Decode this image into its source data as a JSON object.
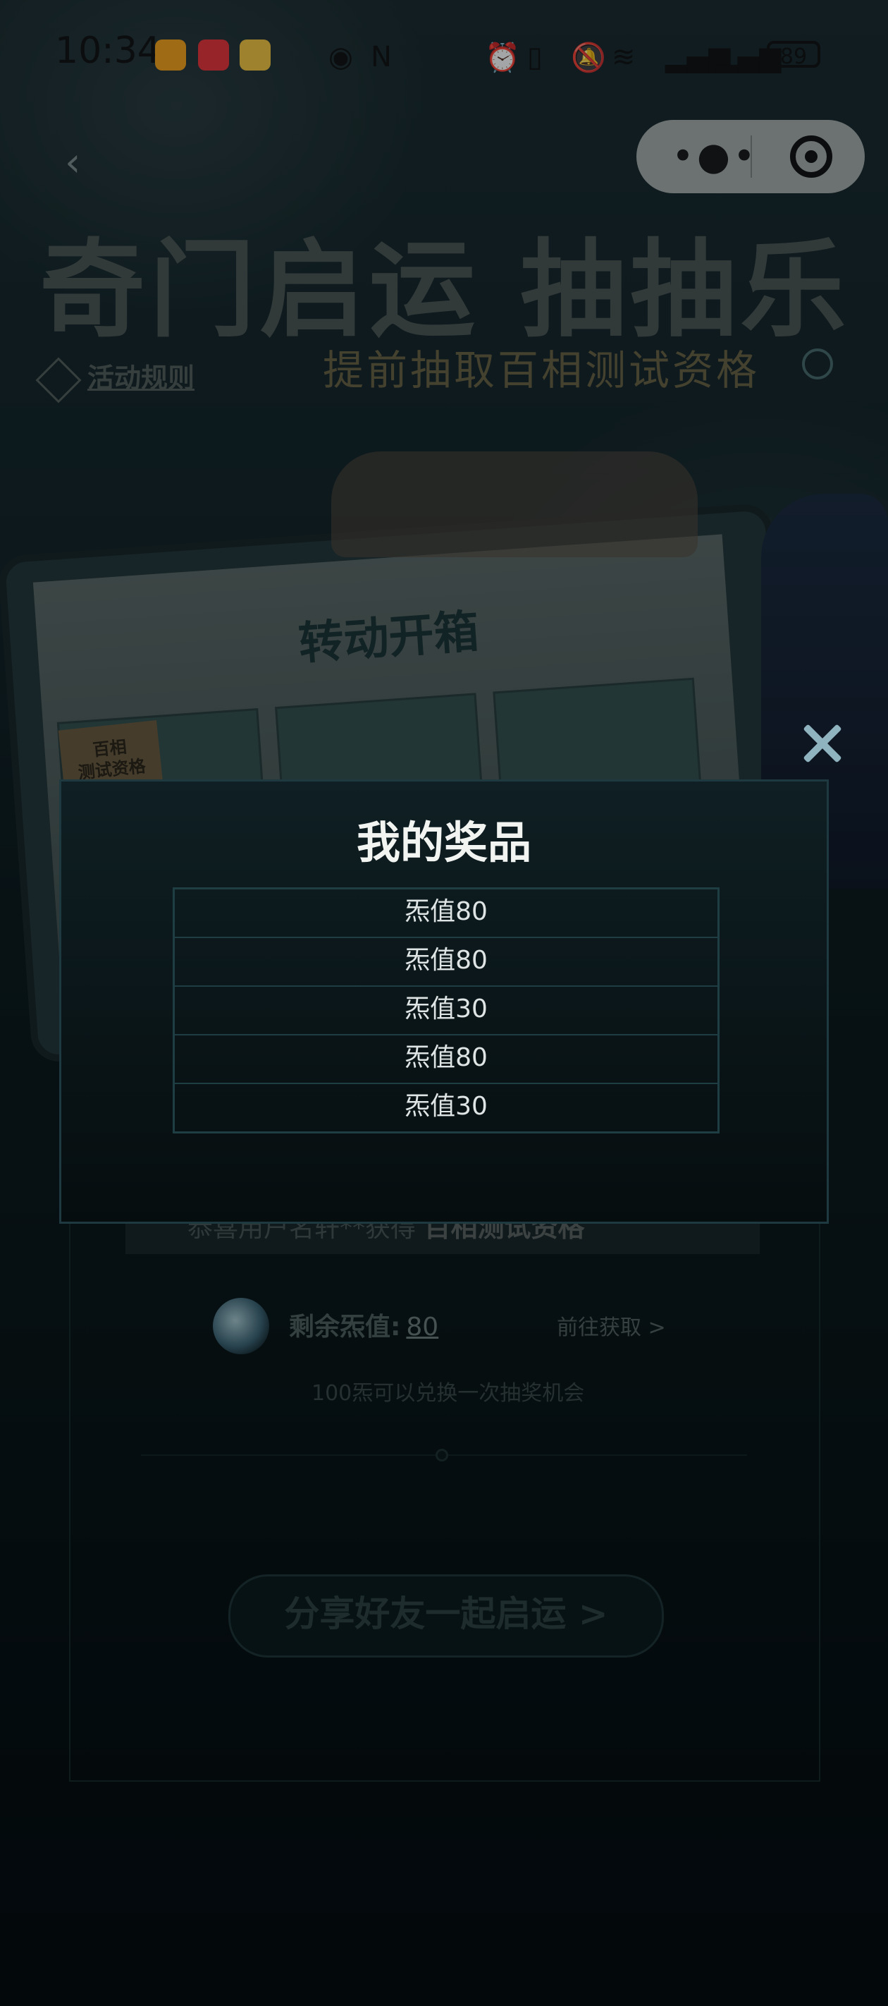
{
  "status_bar": {
    "time": "10:34",
    "battery": "89",
    "icons": [
      "app-icon-orange",
      "huawei-appgallery-icon",
      "weibo-icon",
      "eye-icon",
      "nfc-icon",
      "alarm-icon",
      "vibrate-icon",
      "mute-icon",
      "wifi-icon",
      "signal-icon",
      "signal-icon-2"
    ]
  },
  "capsule": {
    "more_icon": "more-dots-icon",
    "close_icon": "miniprogram-close-icon"
  },
  "header": {
    "title": "奇门启运 抽抽乐",
    "subtitle": "提前抽取百相测试资格",
    "rules_link": "活动规则"
  },
  "art": {
    "phone_title": "转动开箱",
    "stamp_text": "百相\n测试资格"
  },
  "panel": {
    "marquee_text": "恭喜用户名轩**获得",
    "marquee_prize": "百相测试资格",
    "balance_label": "剩余炁值:",
    "balance_value": "80",
    "get_more": "前往获取 >",
    "note": "100炁可以兑换一次抽奖机会",
    "share_button": "分享好友一起启运 >"
  },
  "modal": {
    "title": "我的奖品",
    "prizes": [
      "炁值80",
      "炁值80",
      "炁值30",
      "炁值80",
      "炁值30"
    ],
    "close_icon": "close-x-icon"
  },
  "colors": {
    "modal_bg": "#0b181b",
    "modal_border": "#1e3a40",
    "close_x": "#8fb3bf",
    "capsule": "#a7adab"
  }
}
